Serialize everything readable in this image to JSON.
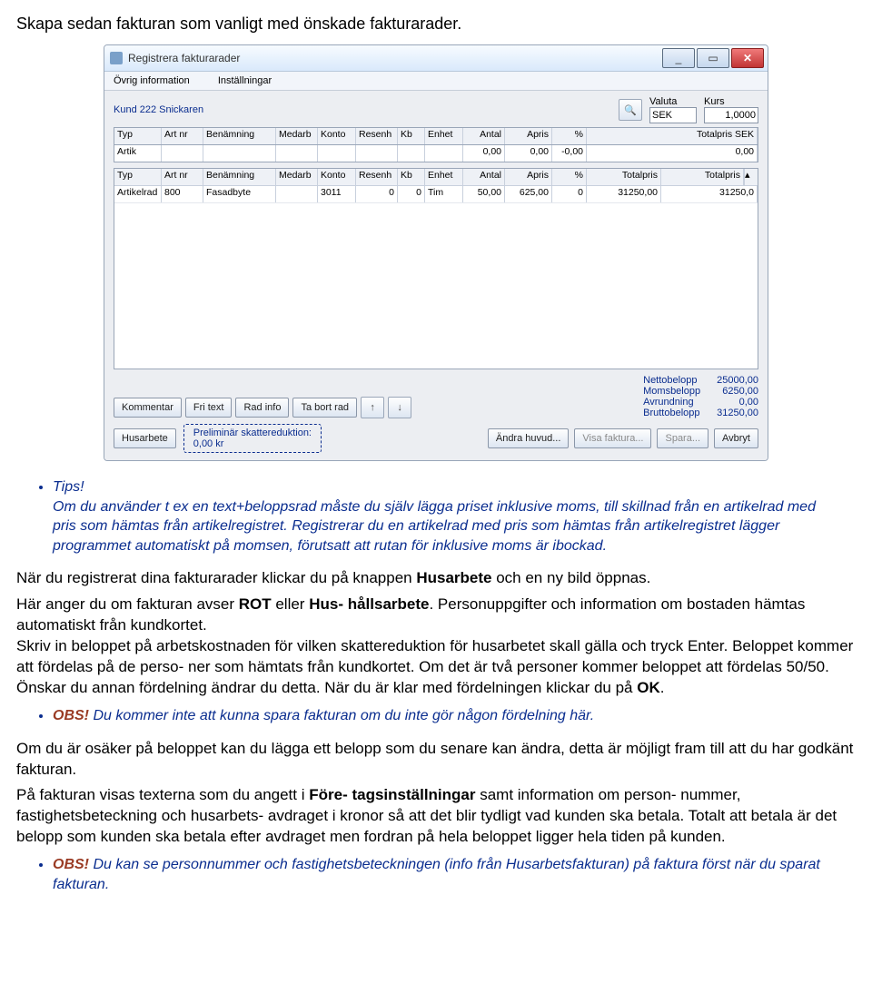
{
  "intro_text": "Skapa sedan fakturan som vanligt med önskade fakturarader.",
  "window": {
    "title": "Registrera fakturarader",
    "menu": {
      "ovrig": "Övrig information",
      "inst": "Inställningar"
    },
    "kund_label": "Kund 222 Snickaren",
    "valuta_label": "Valuta",
    "kurs_label": "Kurs",
    "valuta_value": "SEK",
    "kurs_value": "1,0000",
    "columns": {
      "typ": "Typ",
      "art": "Art nr",
      "ben": "Benämning",
      "med": "Medarb",
      "kon": "Konto",
      "res": "Resenh",
      "kb": "Kb",
      "enh": "Enhet",
      "ant": "Antal",
      "apr": "Apris",
      "pct": "%",
      "tot": "Totalpris SEK",
      "tot1": "Totalpris",
      "tot2": "Totalpris"
    },
    "entry": {
      "typ": "Artik",
      "ant": "0,00",
      "apr": "0,00",
      "pct": "-0,00",
      "tot": "0,00"
    },
    "grid_row": {
      "typ": "Artikelrad",
      "art": "800",
      "ben": "Fasadbyte",
      "med": "",
      "kon": "3011",
      "res": "0",
      "kb": "0",
      "enh": "Tim",
      "ant": "50,00",
      "apr": "625,00",
      "pct": "0",
      "tot1": "31250,00",
      "tot2": "31250,0"
    },
    "bottom_buttons": {
      "kommentar": "Kommentar",
      "fri": "Fri text",
      "rad": "Rad info",
      "tabort": "Ta bort rad"
    },
    "totals": {
      "netto_l": "Nettobelopp",
      "netto_v": "25000,00",
      "moms_l": "Momsbelopp",
      "moms_v": "6250,00",
      "avr_l": "Avrundning",
      "avr_v": "0,00",
      "brutto_l": "Bruttobelopp",
      "brutto_v": "31250,00"
    },
    "husarbete": "Husarbete",
    "skatt_l1": "Preliminär skattereduktion:",
    "skatt_l2": "0,00 kr",
    "lower_buttons": {
      "andra": "Ändra huvud...",
      "visa": "Visa faktura...",
      "spara": "Spara...",
      "avbryt": "Avbryt"
    }
  },
  "tips": {
    "head": "Tips!",
    "body": "Om du använder t ex en text+beloppsrad måste du själv lägga priset inklusive moms, till skillnad från en artikelrad med pris som hämtas från artikelregistret. Registrerar du en artikelrad med pris som hämtas från artikelregistret lägger programmet automatiskt på momsen, förutsatt att rutan för inklusive moms är ibockad."
  },
  "para1_a": "När du registrerat dina fakturarader klickar du på  knappen ",
  "para1_bold": "Husarbete",
  "para1_b": " och en ny bild öppnas.",
  "para2_a": "Här anger du om fakturan avser ",
  "para2_bold1": "ROT",
  "para2_mid": " eller ",
  "para2_bold2": "Hus-  hållsarbete",
  "para2_b": ". Personuppgifter och information om bostaden hämtas automatiskt från kundkortet.",
  "para3": "Skriv in beloppet på arbetskostnaden för vilken  skattereduktion för husarbetet skall gälla och tryck Enter. Beloppet kommer att fördelas på de perso-  ner som hämtats från kundkortet. Om det är två personer kommer beloppet att fördelas 50/50.",
  "para4_a": "Önskar du annan fördelning ändrar du detta. När  du är klar med fördelningen klickar du på ",
  "para4_bold": "OK",
  "para4_b": ".",
  "obs1_head": "OBS!",
  "obs1_body": " Du kommer inte att kunna spara fakturan  om du inte gör någon fördelning här.",
  "para5": "Om du är osäker på beloppet kan du lägga ett  belopp som du senare kan ändra, detta är möjligt fram till att du har godkänt fakturan.",
  "para6_a": "På fakturan visas texterna som du angett i ",
  "para6_bold": "Före-  tagsinställningar",
  "para6_b": " samt information om person- nummer, fastighetsbeteckning och husarbets-  avdraget i kronor så att det blir tydligt vad kunden  ska betala. Totalt att betala är det belopp som  kunden ska betala efter avdraget men fordran på  hela beloppet ligger hela tiden på kunden.",
  "obs2_head": "OBS!",
  "obs2_body": " Du kan se personnummer och fastighetsbeteckningen (info från Husarbetsfakturan) på faktura först när du sparat fakturan."
}
